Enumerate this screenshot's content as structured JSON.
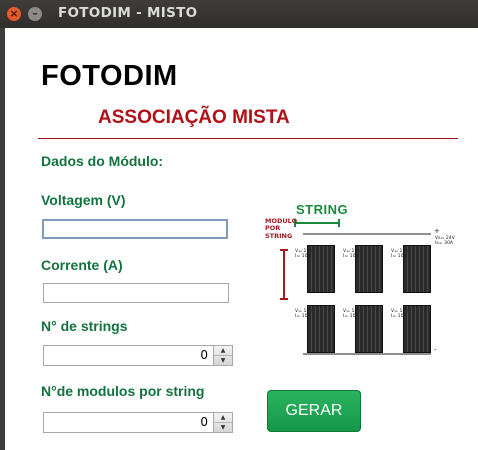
{
  "window": {
    "title": "FOTODIM - MISTO"
  },
  "header": {
    "app_name": "FOTODIM",
    "subtitle": "ASSOCIAÇÃO MISTA"
  },
  "form": {
    "section_label": "Dados do Módulo:",
    "voltage": {
      "label": "Voltagem (V)",
      "value": ""
    },
    "current": {
      "label": "Corrente (A)",
      "value": ""
    },
    "strings": {
      "label": "N° de strings",
      "value": "0"
    },
    "modules": {
      "label": "N°de modulos por string",
      "value": "0"
    }
  },
  "actions": {
    "generate_label": "GERAR"
  },
  "diagram": {
    "string_label": "STRING",
    "modulo_por_string_text": "MODULO POR STRING",
    "module_spec_v": "V= 12V",
    "module_spec_i": "I= 10A",
    "output_v": "Vs= 24V",
    "output_i": "Is= 30A",
    "plus_sign": "+",
    "minus_sign": "-",
    "rows": 2,
    "cols": 3
  },
  "colors": {
    "accent_green": "#13733f",
    "title_red": "#b01016",
    "button_green": "#1ea653"
  },
  "icons": {
    "close": "close-icon",
    "minimize": "minimize-icon",
    "spin_up": "arrow-up-icon",
    "spin_down": "arrow-down-icon"
  }
}
